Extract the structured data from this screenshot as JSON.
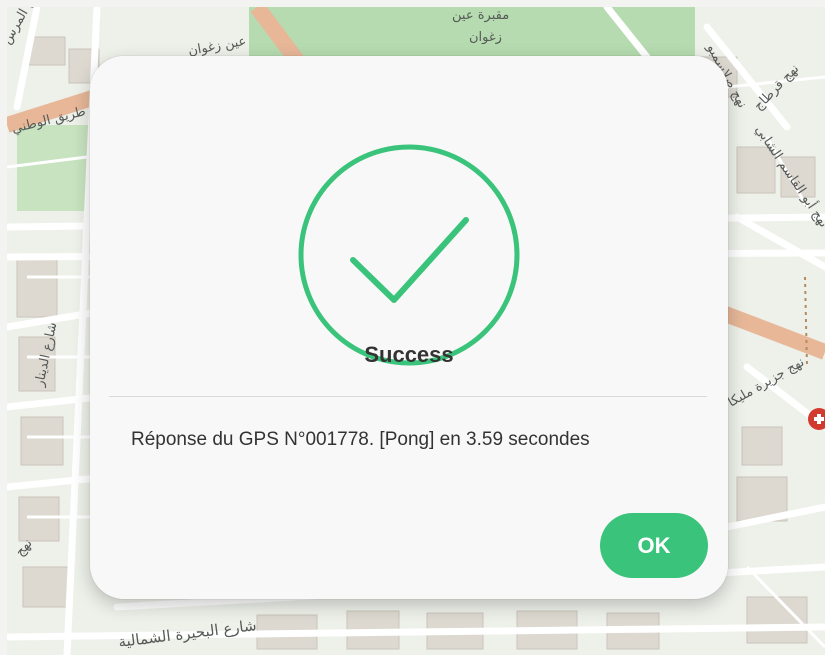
{
  "map": {
    "labels": {
      "top_center": "زغوان",
      "top_center_partial": "مقبرة عين",
      "left_top": "عين زغوان",
      "left_road": "طريق الوطني",
      "left_corner": "نهج المرس",
      "right_top_1": "نهج صلاسمبو",
      "right_top_2": "نهج قرطاج",
      "right_mid": "نهج أبو القاسم الشابي",
      "right_lower": "نهج جزيرة مليكا",
      "left_mid": "شارع الدينار",
      "bottom": "شارع البحيرة الشمالية",
      "left_bottom": "نهج"
    },
    "colors": {
      "park": "#b6dbb0",
      "road": "#e7b798",
      "street": "#ffffff",
      "building": "#d9d6cf",
      "background": "#eef0ea"
    }
  },
  "dialog": {
    "icon": "check-circle-icon",
    "title": "Success",
    "message": "Réponse du GPS N°001778. [Pong] en 3.59 secondes",
    "ok_label": "OK",
    "accent_color": "#3ac37a"
  }
}
